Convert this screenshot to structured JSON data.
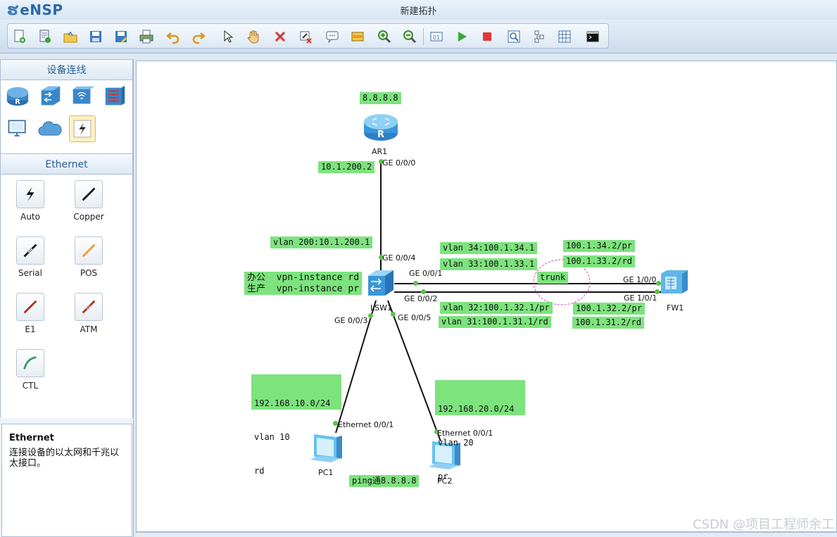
{
  "app": {
    "name": "eNSP",
    "window_title": "新建拓扑"
  },
  "toolbar": {
    "buttons": [
      "new-topology",
      "new-test",
      "open",
      "save",
      "save-as",
      "print",
      "undo",
      "redo",
      "select",
      "pan",
      "delete",
      "delete-link",
      "text-annotation",
      "palette",
      "zoom-in",
      "zoom-out",
      "topo-view",
      "start",
      "stop",
      "capture",
      "group",
      "grid",
      "terminal"
    ]
  },
  "left_panel": {
    "devices_header": "设备连线",
    "devices": [
      "router",
      "switch",
      "wlan",
      "firewall",
      "pc",
      "cloud",
      "connection"
    ],
    "ethernet_header": "Ethernet",
    "cables": [
      {
        "name": "auto",
        "label": "Auto"
      },
      {
        "name": "copper",
        "label": "Copper"
      },
      {
        "name": "serial",
        "label": "Serial"
      },
      {
        "name": "pos",
        "label": "POS"
      },
      {
        "name": "e1",
        "label": "E1"
      },
      {
        "name": "atm",
        "label": "ATM"
      },
      {
        "name": "ctl",
        "label": "CTL"
      }
    ],
    "description": {
      "title": "Ethernet",
      "text": "连接设备的以太网和千兆以太接口。"
    }
  },
  "topology": {
    "devices": {
      "ar1": "AR1",
      "lsw1": "LSW1",
      "fw1": "FW1",
      "pc1": "PC1",
      "pc2": "PC2"
    },
    "ports": {
      "ar1_ge000": "GE 0/0/0",
      "lsw_ge004": "GE 0/0/4",
      "lsw_ge001": "GE 0/0/1",
      "lsw_ge002": "GE 0/0/2",
      "lsw_ge003": "GE 0/0/3",
      "lsw_ge005": "GE 0/0/5",
      "fw_ge100": "GE 1/0/0",
      "fw_ge101": "GE 1/0/1",
      "pc1_eth": "Ethernet 0/0/1",
      "pc2_eth": "Ethernet 0/0/1"
    },
    "labels": {
      "ar1_loopback": "8.8.8.8",
      "ar1_ip": "10.1.200.2",
      "vlan200": "vlan 200:10.1.200.1",
      "vpn_office": "办公  vpn-instance rd",
      "vpn_production": "生产  vpn-instance pr",
      "vlan34": "vlan 34:100.1.34.1",
      "vlan33": "vlan 33:100.1.33.1",
      "vlan32": "vlan 32:100.1.32.1/pr",
      "vlan31": "vlan 31:100.1.31.1/rd",
      "fw_34": "100.1.34.2/pr",
      "fw_33": "100.1.33.2/rd",
      "fw_32": "100.1.32.2/pr",
      "fw_31": "100.1.31.2/rd",
      "trunk": "trunk",
      "pc1_net": [
        "192.168.10.0/24",
        "vlan 10",
        "rd"
      ],
      "pc2_net": [
        "192.168.20.0/24",
        "vlan 20",
        "pr"
      ],
      "ping": "ping通8.8.8.8"
    }
  },
  "watermark": "CSDN @项目工程师余工",
  "colors": {
    "label_bg": "#7de37d",
    "link_dot": "#5cc24a",
    "trunk_ellipse": "#e040c8",
    "accent": "#2b6aa8"
  }
}
